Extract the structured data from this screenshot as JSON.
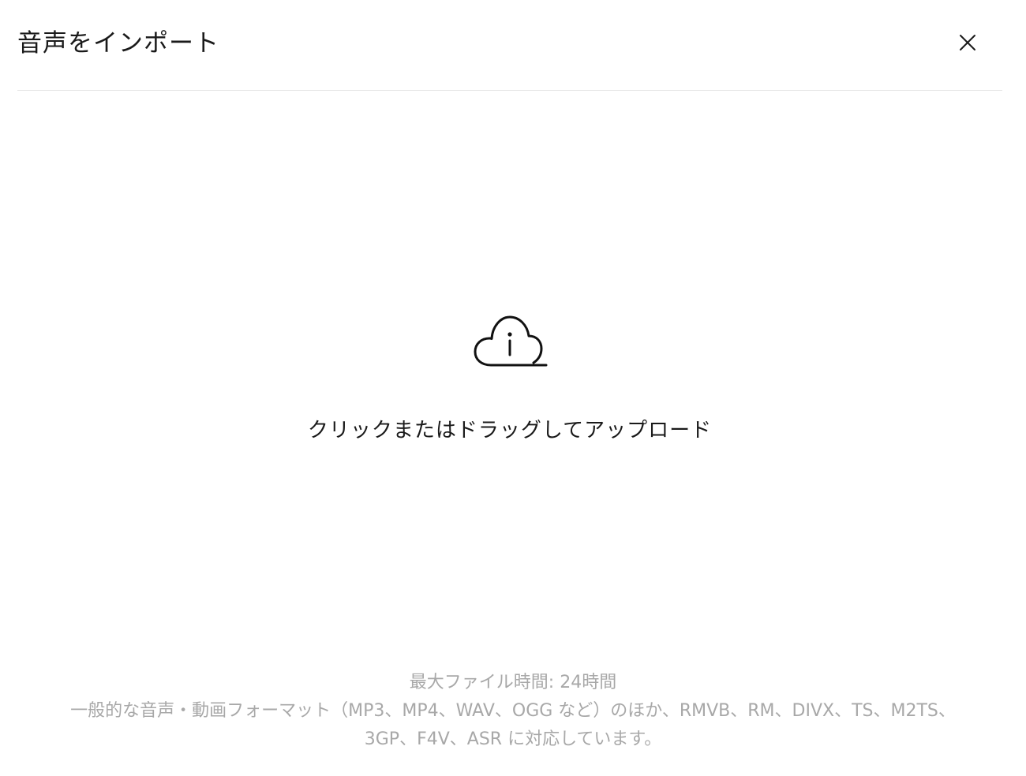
{
  "dialog": {
    "title": "音声をインポート",
    "close_icon": "close-icon"
  },
  "dropzone": {
    "icon": "cloud-upload-icon",
    "label": "クリックまたはドラッグしてアップロード"
  },
  "info": {
    "max_duration": "最大ファイル時間: 24時間",
    "formats_line1": "一般的な音声・動画フォーマット（MP3、MP4、WAV、OGG など）のほか、RMVB、RM、DIVX、TS、M2TS、",
    "formats_line2": "3GP、F4V、ASR に対応しています。"
  }
}
